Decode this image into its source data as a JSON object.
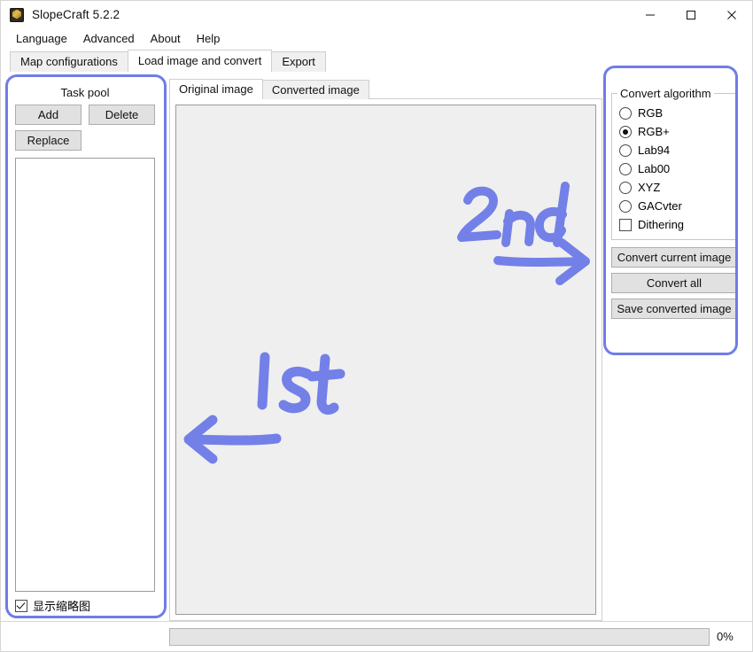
{
  "window": {
    "title": "SlopeCraft 5.2.2",
    "icon": "slopecraft-cube-icon",
    "controls": {
      "minimize": "minimize-icon",
      "maximize": "maximize-icon",
      "close": "close-icon"
    }
  },
  "menubar": {
    "items": [
      {
        "label": "Language"
      },
      {
        "label": "Advanced"
      },
      {
        "label": "About"
      },
      {
        "label": "Help"
      }
    ]
  },
  "tabs": {
    "items": [
      {
        "label": "Map configurations",
        "active": false
      },
      {
        "label": "Load image and convert",
        "active": true
      },
      {
        "label": "Export",
        "active": false
      }
    ]
  },
  "task_pool": {
    "title": "Task pool",
    "add_label": "Add",
    "delete_label": "Delete",
    "replace_label": "Replace",
    "list_items": [],
    "show_thumbnail_label": "显示缩略图",
    "show_thumbnail_checked": true
  },
  "image_panel": {
    "tabs": [
      {
        "label": "Original image",
        "active": true
      },
      {
        "label": "Converted image",
        "active": false
      }
    ]
  },
  "convert_algorithm": {
    "legend": "Convert algorithm",
    "options": [
      {
        "label": "RGB",
        "selected": false
      },
      {
        "label": "RGB+",
        "selected": true
      },
      {
        "label": "Lab94",
        "selected": false
      },
      {
        "label": "Lab00",
        "selected": false
      },
      {
        "label": "XYZ",
        "selected": false
      },
      {
        "label": "GACvter",
        "selected": false
      }
    ],
    "dithering_label": "Dithering",
    "dithering_checked": false,
    "convert_current_label": "Convert current image",
    "convert_all_label": "Convert all",
    "save_converted_label": "Save converted image"
  },
  "statusbar": {
    "progress_percent": 0,
    "progress_label": "0%"
  },
  "annotations": {
    "color": "#7380e8",
    "first": {
      "text": "1st",
      "arrow": "arrow-left"
    },
    "second": {
      "text": "2nd",
      "arrow": "arrow-right"
    },
    "highlight_color": "#6f7ce8",
    "highlight_left": "task-pool-highlight",
    "highlight_right": "convert-algorithm-highlight"
  }
}
